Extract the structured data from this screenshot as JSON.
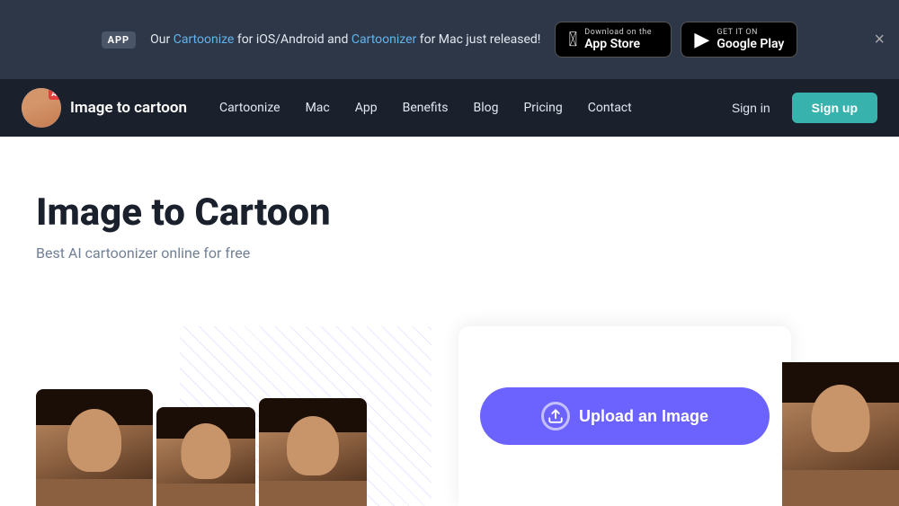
{
  "banner": {
    "app_badge": "APP",
    "text_before_link1": "Our ",
    "link1_text": "Cartoonize",
    "text_between": " for iOS/Android and ",
    "link2_text": "Cartoonizer",
    "text_after": " for Mac just released!",
    "close_label": "×",
    "appstore_sub": "Download on the",
    "appstore_main": "App Store",
    "playstore_sub": "GET IT ON",
    "playstore_main": "Google Play"
  },
  "navbar": {
    "logo_text": "Image to cartoon",
    "ai_badge": "AI",
    "links": [
      {
        "label": "Cartoonize",
        "id": "cartoonize"
      },
      {
        "label": "Mac",
        "id": "mac"
      },
      {
        "label": "App",
        "id": "app"
      },
      {
        "label": "Benefits",
        "id": "benefits"
      },
      {
        "label": "Blog",
        "id": "blog"
      },
      {
        "label": "Pricing",
        "id": "pricing"
      },
      {
        "label": "Contact",
        "id": "contact"
      }
    ],
    "signin_label": "Sign in",
    "signup_label": "Sign up"
  },
  "hero": {
    "title": "Image to Cartoon",
    "subtitle": "Best AI cartoonizer online for free",
    "upload_button_label": "Upload an Image"
  }
}
